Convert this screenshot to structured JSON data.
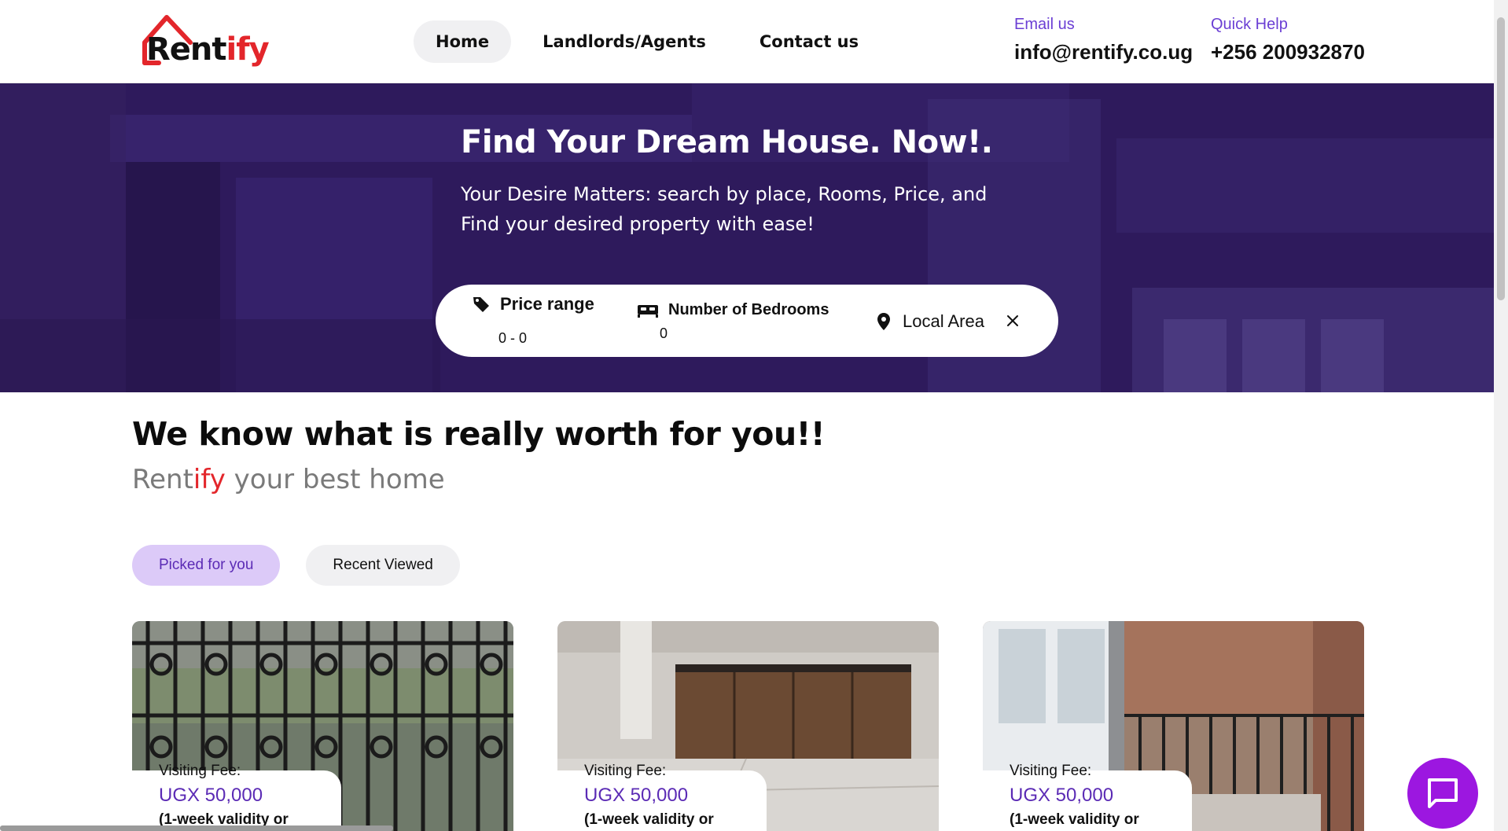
{
  "header": {
    "logo_text_a": "Rent",
    "logo_text_b": "ify",
    "nav": [
      {
        "label": "Home"
      },
      {
        "label": "Landlords/Agents"
      },
      {
        "label": "Contact us"
      }
    ],
    "email_label": "Email us",
    "email_value": "info@rentify.co.ug",
    "help_label": "Quick Help",
    "help_value": "+256 200932870"
  },
  "hero": {
    "title": "Find Your Dream House. Now!.",
    "subtitle": "Your Desire Matters: search by place, Rooms, Price, and Find your desired property with ease!"
  },
  "search": {
    "price_label": "Price range",
    "price_value": "0 - 0",
    "bedrooms_label": "Number of Bedrooms",
    "bedrooms_value": "0",
    "area_label": "Local Area"
  },
  "section": {
    "title": "We know what is really worth for you!!",
    "sub_a": "Rent",
    "sub_b": "ify",
    "sub_c": " your best home"
  },
  "tabs": [
    {
      "label": "Picked for you",
      "active": true
    },
    {
      "label": "Recent Viewed",
      "active": false
    }
  ],
  "cards": [
    {
      "fee_label": "Visiting Fee:",
      "fee_amount": "UGX 50,000",
      "fee_note": "(1-week validity or"
    },
    {
      "fee_label": "Visiting Fee:",
      "fee_amount": "UGX 50,000",
      "fee_note": "(1-week validity or"
    },
    {
      "fee_label": "Visiting Fee:",
      "fee_amount": "UGX 50,000",
      "fee_note": "(1-week validity or"
    }
  ],
  "colors": {
    "accent": "#6b3fd4",
    "brand_red": "#e3262b",
    "hero_bg": "#2f1a5e",
    "chat_button": "#9c17e0",
    "tab_active_bg": "#dccaf8"
  },
  "icons": [
    "house-roof-icon",
    "tag-icon",
    "bed-icon",
    "location-pin-icon",
    "close-icon",
    "chat-icon"
  ]
}
